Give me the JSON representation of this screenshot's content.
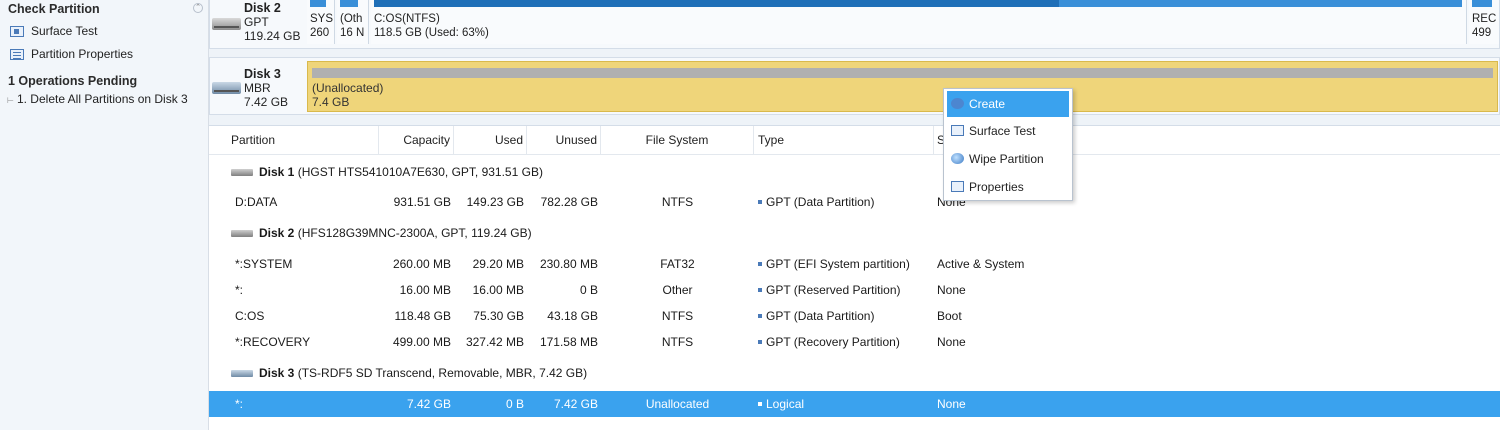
{
  "sidebar": {
    "check_partition_title": "Check Partition",
    "items": [
      {
        "label": "Surface Test",
        "icon": "surface-test-icon"
      },
      {
        "label": "Partition Properties",
        "icon": "properties-icon"
      }
    ],
    "pending_title": "1 Operations Pending",
    "pending_items": [
      {
        "label": "1. Delete All Partitions on Disk 3"
      }
    ]
  },
  "map": {
    "disk2": {
      "name": "Disk 2",
      "type": "GPT",
      "size": "119.24 GB",
      "partitions": [
        {
          "label": "SYS",
          "size": "260"
        },
        {
          "label": "(Oth",
          "size": "16 N"
        },
        {
          "label": "C:OS(NTFS)",
          "size": "118.5 GB (Used: 63%)",
          "used_fraction": 0.63
        },
        {
          "label": "REC",
          "size": "499"
        }
      ]
    },
    "disk3": {
      "name": "Disk 3",
      "type": "MBR",
      "size": "7.42 GB",
      "unalloc_label": "(Unallocated)",
      "unalloc_size": "7.4 GB"
    }
  },
  "table": {
    "columns": [
      "Partition",
      "Capacity",
      "Used",
      "Unused",
      "File System",
      "Type",
      "S"
    ],
    "disks": [
      {
        "name": "Disk 1",
        "desc": "(HGST HTS541010A7E630, GPT, 931.51 GB)",
        "rows": [
          {
            "partition": "D:DATA",
            "capacity": "931.51 GB",
            "used": "149.23 GB",
            "unused": "782.28 GB",
            "fs": "NTFS",
            "type": "GPT (Data Partition)",
            "status": "None"
          }
        ]
      },
      {
        "name": "Disk 2",
        "desc": "(HFS128G39MNC-2300A, GPT, 119.24 GB)",
        "rows": [
          {
            "partition": "*:SYSTEM",
            "capacity": "260.00 MB",
            "used": "29.20 MB",
            "unused": "230.80 MB",
            "fs": "FAT32",
            "type": "GPT (EFI System partition)",
            "status": "Active & System"
          },
          {
            "partition": "*:",
            "capacity": "16.00 MB",
            "used": "16.00 MB",
            "unused": "0 B",
            "fs": "Other",
            "type": "GPT (Reserved Partition)",
            "status": "None"
          },
          {
            "partition": "C:OS",
            "capacity": "118.48 GB",
            "used": "75.30 GB",
            "unused": "43.18 GB",
            "fs": "NTFS",
            "type": "GPT (Data Partition)",
            "status": "Boot"
          },
          {
            "partition": "*:RECOVERY",
            "capacity": "499.00 MB",
            "used": "327.42 MB",
            "unused": "171.58 MB",
            "fs": "NTFS",
            "type": "GPT (Recovery Partition)",
            "status": "None"
          }
        ]
      },
      {
        "name": "Disk 3",
        "desc": "(TS-RDF5 SD Transcend, Removable, MBR, 7.42 GB)",
        "rows": [
          {
            "partition": "*:",
            "capacity": "7.42 GB",
            "used": "0 B",
            "unused": "7.42 GB",
            "fs": "Unallocated",
            "type": "Logical",
            "status": "None"
          }
        ]
      }
    ]
  },
  "context_menu": {
    "items": [
      {
        "label": "Create",
        "icon": "create-icon"
      },
      {
        "label": "Surface Test",
        "icon": "surface-test-icon"
      },
      {
        "label": "Wipe Partition",
        "icon": "wipe-icon"
      },
      {
        "label": "Properties",
        "icon": "properties-icon"
      }
    ]
  },
  "colors": {
    "selection": "#3aa2ee",
    "unallocated": "#efd57a",
    "used_bar": "#1f6fb8",
    "free_bar": "#3a8fd8"
  }
}
